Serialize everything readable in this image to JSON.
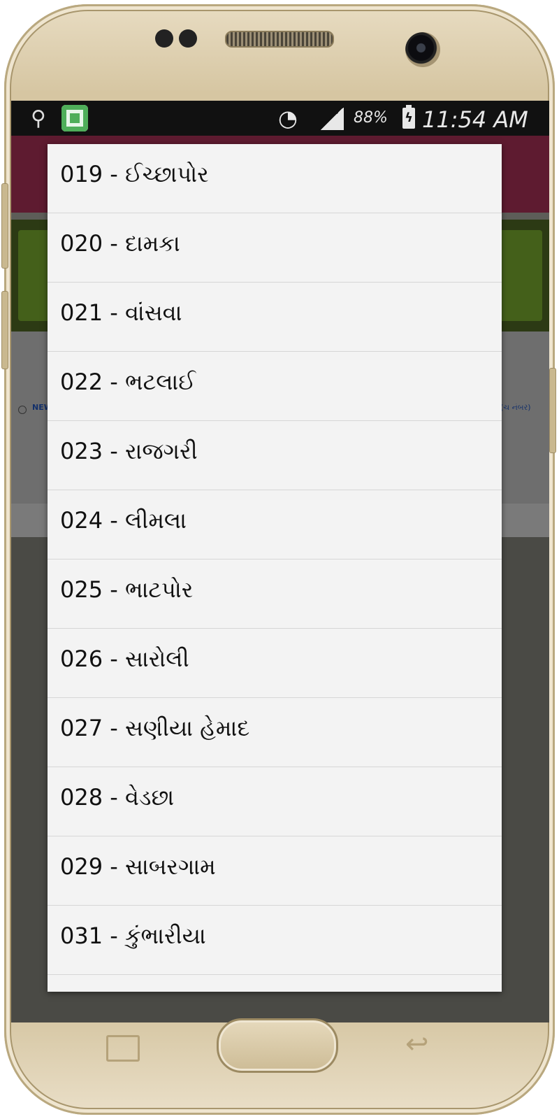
{
  "status_bar": {
    "usb_icon": "usb-icon",
    "app_icon": "app-notification-icon",
    "wifi_icon": "wifi-icon",
    "signal_icon": "signal-icon",
    "battery_percent": "88%",
    "battery_icon": "battery-charging-icon",
    "time": "11:54 AM"
  },
  "background": {
    "radio_left_text": "NEW",
    "radio_right_text": "(ચ નંબર)"
  },
  "dialog": {
    "items": [
      {
        "label": "019 - ઈચ્છાપોર"
      },
      {
        "label": "020 - દામકા"
      },
      {
        "label": "021 - વાંસવા"
      },
      {
        "label": "022 - ભટલાઈ"
      },
      {
        "label": "023 - રાજગરી"
      },
      {
        "label": "024 - લીમલા"
      },
      {
        "label": "025 - ભાટપોર"
      },
      {
        "label": "026 - સારોલી"
      },
      {
        "label": "027 - સણીયા હેમાદ"
      },
      {
        "label": "028 - વેડછા"
      },
      {
        "label": "029 - સાબરગામ"
      },
      {
        "label": "031 - કુંભારીયા"
      }
    ]
  },
  "colors": {
    "app_bar": "#5e1b30",
    "dialog_bg": "#f3f3f3",
    "divider": "#d6d6d6",
    "phone_body": "#d6c6a2"
  }
}
